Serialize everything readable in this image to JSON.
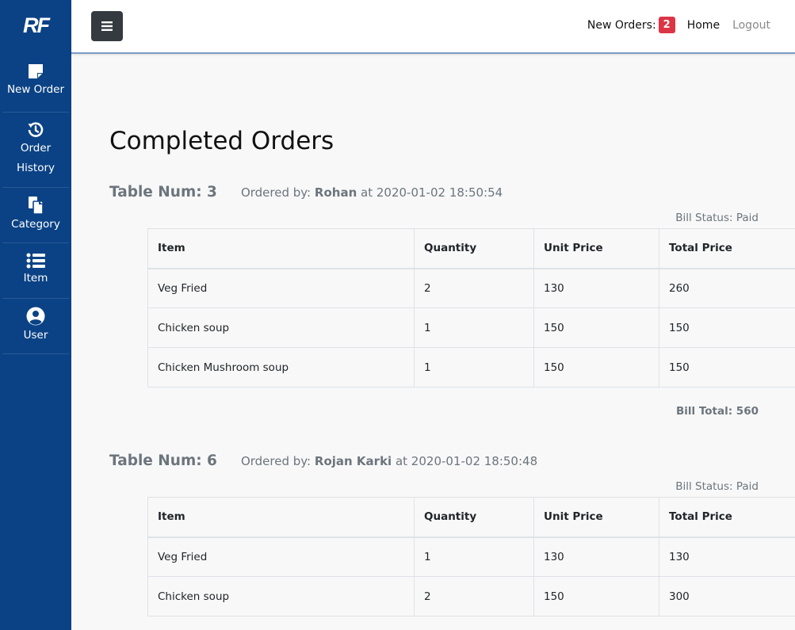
{
  "sidebar": {
    "logo": "RF",
    "items": [
      {
        "label": "New Order",
        "icon": "sticky-note-icon"
      },
      {
        "label_line1": "Order",
        "label_line2": "History",
        "icon": "history-icon"
      },
      {
        "label": "Category",
        "icon": "copy-icon"
      },
      {
        "label": "Item",
        "icon": "list-icon"
      },
      {
        "label": "User",
        "icon": "user-circle-icon"
      }
    ]
  },
  "topbar": {
    "menu_icon": "hamburger-icon",
    "new_orders_label": "New Orders:",
    "new_orders_count": "2",
    "home_label": "Home",
    "logout_label": "Logout"
  },
  "page": {
    "title": "Completed Orders"
  },
  "table_headers": [
    "Item",
    "Quantity",
    "Unit Price",
    "Total Price"
  ],
  "orders": [
    {
      "table_num": "Table Num: 3",
      "ordered_by_prefix": "Ordered by:",
      "ordered_by_name": "Rohan",
      "ordered_at": "at 2020-01-02 18:50:54",
      "bill_status": "Bill Status: Paid",
      "rows": [
        {
          "item": "Veg Fried",
          "quantity": "2",
          "unit_price": "130",
          "total_price": "260"
        },
        {
          "item": "Chicken soup",
          "quantity": "1",
          "unit_price": "150",
          "total_price": "150"
        },
        {
          "item": "Chicken Mushroom soup",
          "quantity": "1",
          "unit_price": "150",
          "total_price": "150"
        }
      ],
      "bill_total": "Bill Total: 560"
    },
    {
      "table_num": "Table Num: 6",
      "ordered_by_prefix": "Ordered by:",
      "ordered_by_name": "Rojan Karki",
      "ordered_at": "at 2020-01-02 18:50:48",
      "bill_status": "Bill Status: Paid",
      "rows": [
        {
          "item": "Veg Fried",
          "quantity": "1",
          "unit_price": "130",
          "total_price": "130"
        },
        {
          "item": "Chicken soup",
          "quantity": "2",
          "unit_price": "150",
          "total_price": "300"
        }
      ]
    }
  ],
  "colors": {
    "sidebar": "#0b4285",
    "badge": "#dc3545",
    "menu_button": "#343a40"
  }
}
